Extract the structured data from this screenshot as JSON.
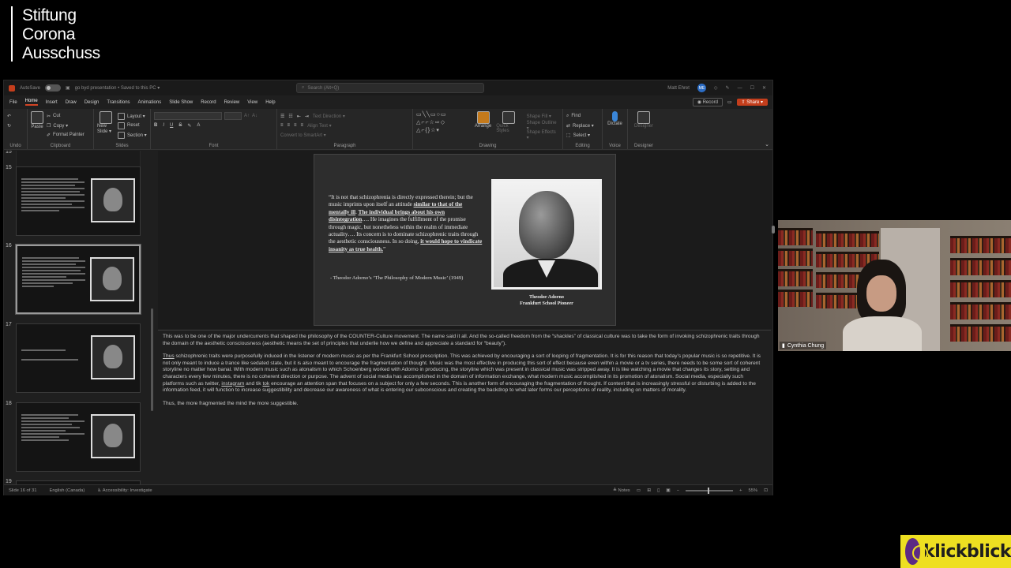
{
  "brand": {
    "line1": "Stiftung",
    "line2": "Corona",
    "line3": "Ausschuss"
  },
  "app": {
    "autosave_label": "AutoSave",
    "doc_title": "go byd presentation • Saved to this PC ▾",
    "search_placeholder": "Search (Alt+Q)",
    "user_name": "Matt Ehret",
    "user_initials": "ME"
  },
  "menu": {
    "tabs": [
      "File",
      "Home",
      "Insert",
      "Draw",
      "Design",
      "Transitions",
      "Animations",
      "Slide Show",
      "Record",
      "Review",
      "View",
      "Help"
    ],
    "active": "Home",
    "record_label": "◉ Record",
    "share_label": "⇧ Share ▾"
  },
  "ribbon": {
    "undo_group": "Undo",
    "clipboard": {
      "paste": "Paste",
      "cut": "Cut",
      "copy": "Copy ▾",
      "format_painter": "Format Painter",
      "label": "Clipboard"
    },
    "slides": {
      "new_slide": "New Slide ▾",
      "layout": "Layout ▾",
      "reset": "Reset",
      "section": "Section ▾",
      "label": "Slides"
    },
    "font": {
      "label": "Font",
      "b": "B",
      "i": "I",
      "u": "U",
      "s": "S"
    },
    "paragraph": {
      "label": "Paragraph",
      "text_direction": "Text Direction ▾",
      "align_text": "Align Text ▾",
      "smartart": "Convert to SmartArt ▾"
    },
    "drawing": {
      "label": "Drawing",
      "arrange": "Arrange",
      "quick_styles": "Quick Styles",
      "shape_fill": "Shape Fill ▾",
      "shape_outline": "Shape Outline ▾",
      "shape_effects": "Shape Effects ▾"
    },
    "editing": {
      "label": "Editing",
      "find": "Find",
      "replace": "Replace ▾",
      "select": "Select ▾"
    },
    "voice": {
      "label": "Voice",
      "dictate": "Dictate"
    },
    "designer": {
      "label": "Designer",
      "designer": "Designer"
    }
  },
  "thumbnails": {
    "items": [
      {
        "num": "15",
        "selected": false
      },
      {
        "num": "16",
        "selected": true
      },
      {
        "num": "17",
        "selected": false
      },
      {
        "num": "18",
        "selected": false
      }
    ],
    "next_num": "19"
  },
  "slide": {
    "quote_p1": "“It is not that schizophrenia is directly expressed therein; but the music imprints upon itself an attitude ",
    "quote_u1": "similar to that of the mentally ill",
    "quote_p2": ". ",
    "quote_u2": "The individual brings about his own disintegration",
    "quote_p3": "…. He imagines the fulfillment of the promise through magic, but nonetheless within the realm of immediate actuality…. Its concern is to dominate schizophrenic traits through the aesthetic consciousness. In so doing, ",
    "quote_u3": "it would hope to vindicate insanity as true health.",
    "quote_p4": "”",
    "attribution": "- Theodor Adorno’s ‘The Philosophy of Modern Music’ (1949)",
    "caption_name": "Theodor Adorno",
    "caption_role": "Frankfurt School Pioneer"
  },
  "notes": {
    "p1": "This was to be one of the major undercurrents that shaped the philosophy of the COUNTER-Culture movement. The name said it all. And the so-called freedom from the “shackles” of classical culture was to take the form of invoking schizophrenic traits through the domain of the aesthetic consciousness (aesthetic means the set of principles that underlie how we define and appreciate a standard for “beauty”).",
    "p2_u": "Thus",
    "p2_a": " schizophrenic traits were purposefully induced in the listener of modern music as per the Frankfurt School prescription. This was achieved by encouraging a sort of looping of fragmentation. It is for this reason that today’s popular music is so repetitive. It is not only meant to induce a trance like sedated state, but it is also meant to encourage the fragmentation of thought. Music was the most effective in producing this sort of effect because even within a movie or a tv series, there needs to be some sort of coherent storyline no matter how banal. With modern music such as atonalism to which Schoenberg worked with Adorno in producing, the storyline which was present in classical music was stripped away. It is like watching a movie that changes its story, setting and characters every few minutes, there is no coherent direction or purpose. The advent of social media has accomplished in the domain of information exchange, what modern music accomplished in its promotion of atonalism.  Social media, especially such platforms such as twitter, ",
    "p2_u2": "instagram",
    "p2_b": " and tik ",
    "p2_u3": "tok",
    "p2_c": " encourage an attention span that focuses on a subject for only a few seconds. This is another form of encouraging the fragmentation of thought. If content that is increasingly stressful or disturbing is added to the information feed, it will function to increase suggestibility and decrease our awareness of what is entering our subconscious and creating the backdrop to what later forms our perceptions of reality, including on matters of morality.",
    "p3": "Thus, the more fragmented the mind the more suggestible."
  },
  "status": {
    "slide_of": "Slide 16 of 31",
    "language": "English (Canada)",
    "accessibility": "♿ Accessibility: Investigate",
    "notes": "≜ Notes",
    "zoom": "55%"
  },
  "webcam": {
    "participant_name": "Cynthia Chung",
    "signal_icon": "signal-bars-icon"
  },
  "logo": {
    "text": "klickblick"
  },
  "colors": {
    "accent": "#c43e1c",
    "logo_bg": "#eedf21",
    "logo_purple": "#5c2a84"
  }
}
